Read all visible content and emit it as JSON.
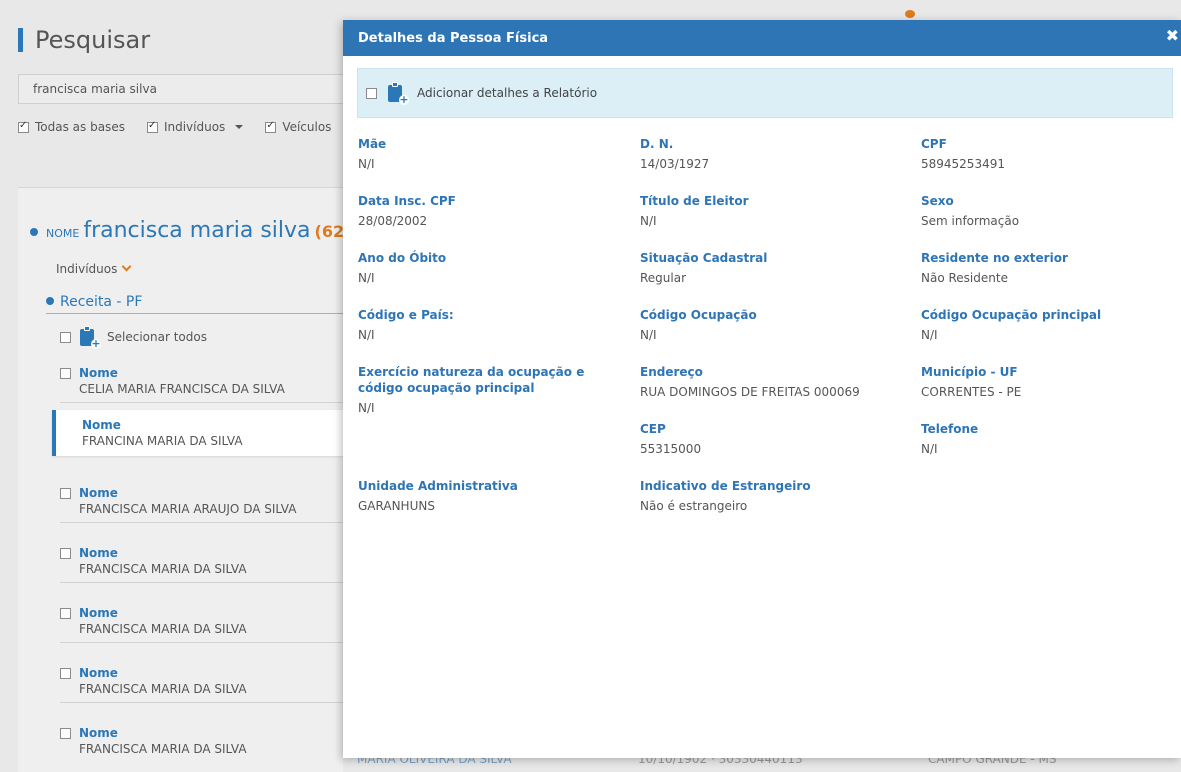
{
  "page": {
    "title": "Pesquisar",
    "search_value": "francisca maria silva",
    "filters": [
      {
        "label": "Todas as bases",
        "checked": true
      },
      {
        "label": "Indivíduos",
        "checked": true
      },
      {
        "label": "Veículos",
        "checked": true
      }
    ]
  },
  "results": {
    "nome_kind": "NOME",
    "query": "francisca maria silva",
    "count": "(62)",
    "group_label": "Indivíduos",
    "source": "Receita - PF",
    "select_all": "Selecionar todos",
    "items": [
      {
        "label": "Nome",
        "value": "CELIA MARIA FRANCISCA DA SILVA"
      },
      {
        "label": "Nome",
        "value": "FRANCINA MARIA DA SILVA"
      },
      {
        "label": "Nome",
        "value": "FRANCISCA MARIA ARAUJO DA SILVA"
      },
      {
        "label": "Nome",
        "value": "FRANCISCA MARIA DA SILVA"
      },
      {
        "label": "Nome",
        "value": "FRANCISCA MARIA DA SILVA"
      },
      {
        "label": "Nome",
        "value": "FRANCISCA MARIA DA SILVA"
      },
      {
        "label": "Nome",
        "value": "FRANCISCA MARIA DA SILVA"
      }
    ],
    "bottom_peek": [
      "MARIA OLIVEIRA DA SILVA",
      "10/10/1902 · 30330440113",
      "CAMPO GRANDE - MS"
    ]
  },
  "modal": {
    "title": "Detalhes da Pessoa Física",
    "add_report_label": "Adicionar detalhes a Relatório",
    "fields": [
      {
        "key": "Mãe",
        "value": "N/I"
      },
      {
        "key": "D. N.",
        "value": "14/03/1927"
      },
      {
        "key": "CPF",
        "value": "58945253491"
      },
      {
        "key": "Data Insc. CPF",
        "value": "28/08/2002"
      },
      {
        "key": "Título de Eleitor",
        "value": "N/I"
      },
      {
        "key": "Sexo",
        "value": "Sem informação"
      },
      {
        "key": "Ano do Óbito",
        "value": "N/I"
      },
      {
        "key": "Situação Cadastral",
        "value": "Regular"
      },
      {
        "key": "Residente no exterior",
        "value": "Não Residente"
      },
      {
        "key": "Código e País:",
        "value": "N/I"
      },
      {
        "key": "Código Ocupação",
        "value": "N/I"
      },
      {
        "key": "Código Ocupação principal",
        "value": "N/I"
      },
      {
        "key": "Exercício natureza da ocupação e código ocupação principal",
        "value": "N/I"
      },
      {
        "key": "Endereço",
        "value": "RUA DOMINGOS DE FREITAS 000069"
      },
      {
        "key": "Município - UF",
        "value": "CORRENTES - PE"
      },
      {
        "key": "CEP",
        "value": "55315000"
      },
      {
        "key": "Telefone",
        "value": "N/I"
      },
      {
        "key": "Unidade Administrativa",
        "value": "GARANHUNS"
      },
      {
        "key": "Indicativo de Estrangeiro",
        "value": "Não é estrangeiro"
      }
    ]
  },
  "colors": {
    "primary": "#2e75b6",
    "accent": "#e07a1a",
    "info_bg": "#dceef6"
  }
}
